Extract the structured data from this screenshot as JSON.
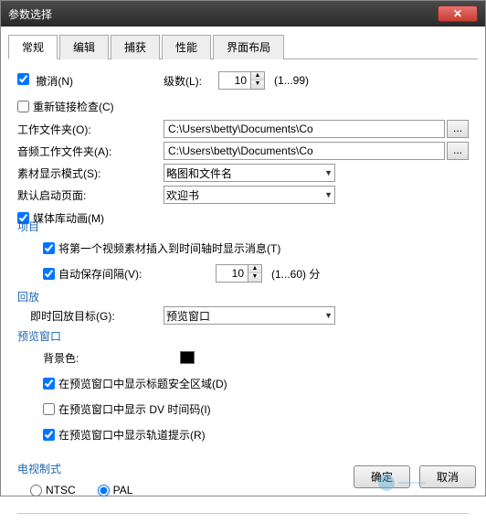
{
  "window": {
    "title": "参数选择",
    "close": "✕"
  },
  "tabs": [
    "常规",
    "编辑",
    "捕获",
    "性能",
    "界面布局"
  ],
  "general": {
    "undo": "撤消(N)",
    "relink": "重新链接检查(C)",
    "levels_label": "级数(L):",
    "levels_value": "10",
    "levels_range": "(1...99)",
    "work_folder_label": "工作文件夹(O):",
    "work_folder_value": "C:\\Users\\betty\\Documents\\Co",
    "audio_folder_label": "音频工作文件夹(A):",
    "audio_folder_value": "C:\\Users\\betty\\Documents\\Co",
    "browse": "...",
    "display_mode_label": "素材显示模式(S):",
    "display_mode_value": "略图和文件名",
    "startup_page_label": "默认启动页面:",
    "startup_page_value": "欢迎书",
    "lib_anim": "媒体库动画(M)"
  },
  "project": {
    "header": "项目",
    "insert_msg": "将第一个视频素材插入到时间轴时显示消息(T)",
    "autosave_label": "自动保存间隔(V):",
    "autosave_value": "10",
    "autosave_range": "(1...60) 分"
  },
  "playback": {
    "header": "回放",
    "target_label": "即时回放目标(G):",
    "target_value": "预览窗口"
  },
  "preview": {
    "header": "预览窗口",
    "bg_label": "背景色:",
    "safe_area": "在预览窗口中显示标题安全区域(D)",
    "dv_timecode": "在预览窗口中显示 DV 时间码(I)",
    "track_tip": "在预览窗口中显示轨道提示(R)"
  },
  "tv": {
    "header": "电视制式",
    "ntsc": "NTSC",
    "pal": "PAL"
  },
  "buttons": {
    "ok": "确定",
    "cancel": "取消"
  }
}
